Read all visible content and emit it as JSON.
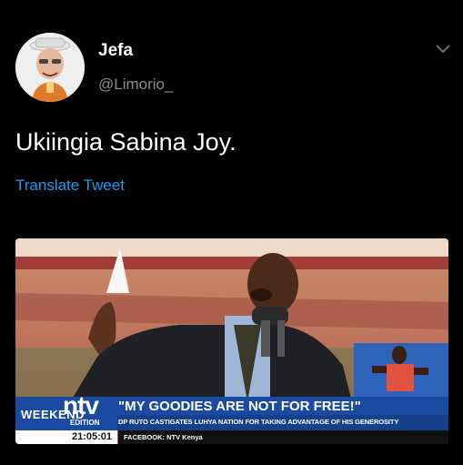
{
  "tweet": {
    "author_name": "Jefa",
    "author_handle": "@Limorio_",
    "text": "Ukiingia Sabina Joy.",
    "translate_label": "Translate Tweet"
  },
  "media": {
    "ticker": {
      "channel": "ntv",
      "weekend_label": "WEEKEND",
      "edition_label": "EDITION",
      "headline": "\"MY GOODIES ARE NOT FOR FREE!\"",
      "subheadline": "DP RUTO CASTIGATES LUHYA NATION FOR TAKING ADVANTAGE OF HIS GENEROSITY",
      "time": "21:05:01",
      "footer": "FACEBOOK: NTV Kenya"
    }
  },
  "icons": {
    "menu": "chevron-down-icon"
  },
  "colors": {
    "background": "#000000",
    "link": "#1d9bf0",
    "muted": "#8a8d91",
    "ticker_blue": "#1b4aa3"
  }
}
